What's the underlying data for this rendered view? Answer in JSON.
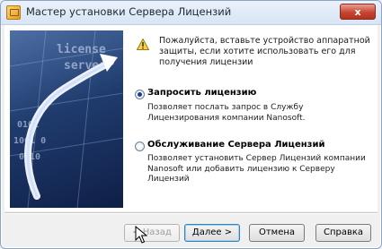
{
  "window": {
    "title": "Мастер установки Сервера Лицензий",
    "close_label": "x",
    "app_icon": "key-window-icon"
  },
  "banner": {
    "line1": "license",
    "line2": "server",
    "digits1": "0101",
    "digits2": "1001 0",
    "digits3": "0 10"
  },
  "notice": {
    "icon": "warning-icon",
    "text": "Пожалуйста, вставьте устройство аппаратной защиты, если хотите использовать его для получения лицензии"
  },
  "options": [
    {
      "label": "Запросить лицензию",
      "description": "Позволяет послать запрос в Службу Лицензирования компании Nanosoft.",
      "selected": true
    },
    {
      "label": "Обслуживание Сервера Лицензий",
      "description": "Позволяет установить Сервер Лицензий компании Nanosoft или добавить лицензию к Серверу Лицензий",
      "selected": false
    }
  ],
  "buttons": {
    "back": "< Назад",
    "next": "Далее >",
    "cancel": "Отмена",
    "help": "Справка"
  }
}
